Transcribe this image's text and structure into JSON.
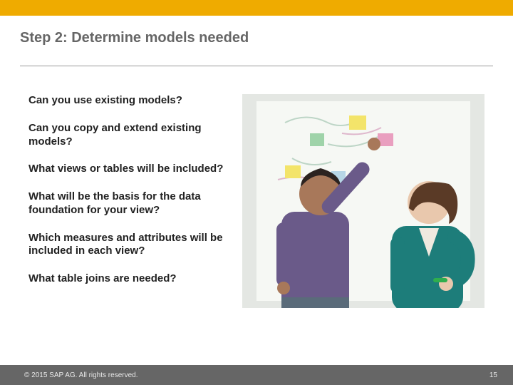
{
  "title": "Step 2: Determine models needed",
  "questions": [
    "Can you use existing models?",
    "Can you copy and extend existing models?",
    "What views or tables will be included?",
    "What will be the basis for the data foundation for your view?",
    "Which measures and attributes will be included in each view?",
    "What table joins are needed?"
  ],
  "footer": {
    "copyright": "© 2015 SAP AG. All rights reserved.",
    "page_number": "15"
  }
}
